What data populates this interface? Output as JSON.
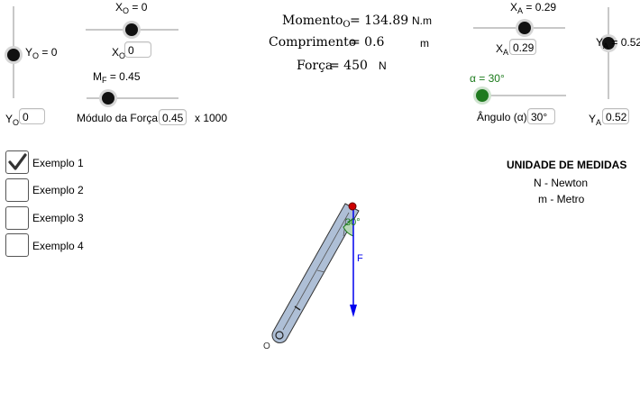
{
  "sliders": {
    "xo": {
      "label": "X",
      "sub": "O",
      "value_text": " = 0"
    },
    "yo": {
      "label": "Y",
      "sub": "O",
      "value_text": " = 0"
    },
    "mf": {
      "label": "M",
      "sub": "F",
      "value_text": " = 0.45"
    },
    "xa": {
      "label": "X",
      "sub": "A",
      "value_text": " = 0.29"
    },
    "ya": {
      "label": "Y",
      "sub": "A",
      "value_text": " = 0.52"
    },
    "alpha": {
      "label": "α = 30°"
    }
  },
  "inputs": {
    "xo": {
      "label": "X",
      "sub": "O",
      "value": "0"
    },
    "yo": {
      "label": "Y",
      "sub": "O",
      "value": "0"
    },
    "force_module": {
      "label": "Módulo da Força",
      "value": "0.45",
      "suffix": "x 1000"
    },
    "xa": {
      "label": "X",
      "sub": "A",
      "value": "0.29"
    },
    "ya": {
      "label": "Y",
      "sub": "A",
      "value": "0.52"
    },
    "angle": {
      "label": "Ângulo (α)",
      "value": "30°"
    }
  },
  "equations": {
    "momento": {
      "name": "Momento",
      "sub": "O",
      "value": "= 134.89",
      "unit": "N.m"
    },
    "comprimento": {
      "name": "Comprimento",
      "value": "= 0.6",
      "unit": "m"
    },
    "forca": {
      "name": "Força",
      "value": "= 450",
      "unit": "N"
    }
  },
  "examples": [
    {
      "label": "Exemplo 1",
      "checked": true
    },
    {
      "label": "Exemplo 2",
      "checked": false
    },
    {
      "label": "Exemplo 3",
      "checked": false
    },
    {
      "label": "Exemplo 4",
      "checked": false
    }
  ],
  "units_box": {
    "title": "UNIDADE DE MEDIDAS",
    "line1": "N - Newton",
    "line2": "m - Metro"
  },
  "diagram": {
    "origin_label": "O",
    "force_label": "F",
    "angle_label": "30°",
    "colors": {
      "bar": "#aebfd6",
      "force": "#0000ee",
      "angle": "#1a7a1a",
      "pin": "#cc0000"
    }
  }
}
